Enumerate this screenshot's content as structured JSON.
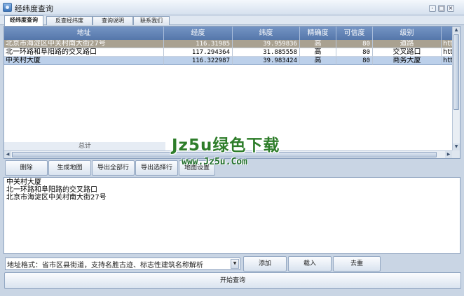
{
  "window": {
    "title": "经纬度查询",
    "controls": [
      "-",
      "□",
      "×"
    ]
  },
  "tabs": [
    {
      "label": "经纬度查询",
      "active": true
    },
    {
      "label": "反查经纬度",
      "active": false
    },
    {
      "label": "查询说明",
      "active": false
    },
    {
      "label": "联系我们",
      "active": false
    }
  ],
  "table": {
    "columns": [
      "地址",
      "经度",
      "纬度",
      "精确度",
      "可信度",
      "级别",
      ""
    ],
    "rows": [
      [
        "北京市海淀区中关村南大街27号",
        "116.31985",
        "39.959836",
        "高",
        "80",
        "道路",
        "htt"
      ],
      [
        "北一环路和阜阳路的交叉路口",
        "117.294364",
        "31.885558",
        "高",
        "80",
        "交叉路口",
        "htt"
      ],
      [
        "中关村大厦",
        "116.322987",
        "39.983424",
        "高",
        "80",
        "商务大厦",
        "htt"
      ]
    ],
    "total_label": "总计"
  },
  "actions": {
    "delete": "删除",
    "make_map": "生成地图",
    "export_all": "导出全部行",
    "export_selected": "导出选择行",
    "map_settings": "地图设置"
  },
  "results_lines": [
    "中关村大厦",
    "北一环路和阜阳路的交叉路口",
    "北京市海淀区中关村南大街27号"
  ],
  "address_input": {
    "value": "地址格式：省市区县街道，支持名胜古迹、标志性建筑名称解析"
  },
  "buttons": {
    "add": "添加",
    "load": "载入",
    "dedupe": "去重",
    "start_query": "开始查询"
  },
  "watermark": {
    "top": "Jz5u绿色下载",
    "bottom": "www.Jz5u.Com"
  },
  "colors": {
    "header_bg": "#6485b8",
    "selected_row": "#a9a191",
    "alt_row": "#bcd0ea",
    "watermark": "#2e7d2a"
  }
}
